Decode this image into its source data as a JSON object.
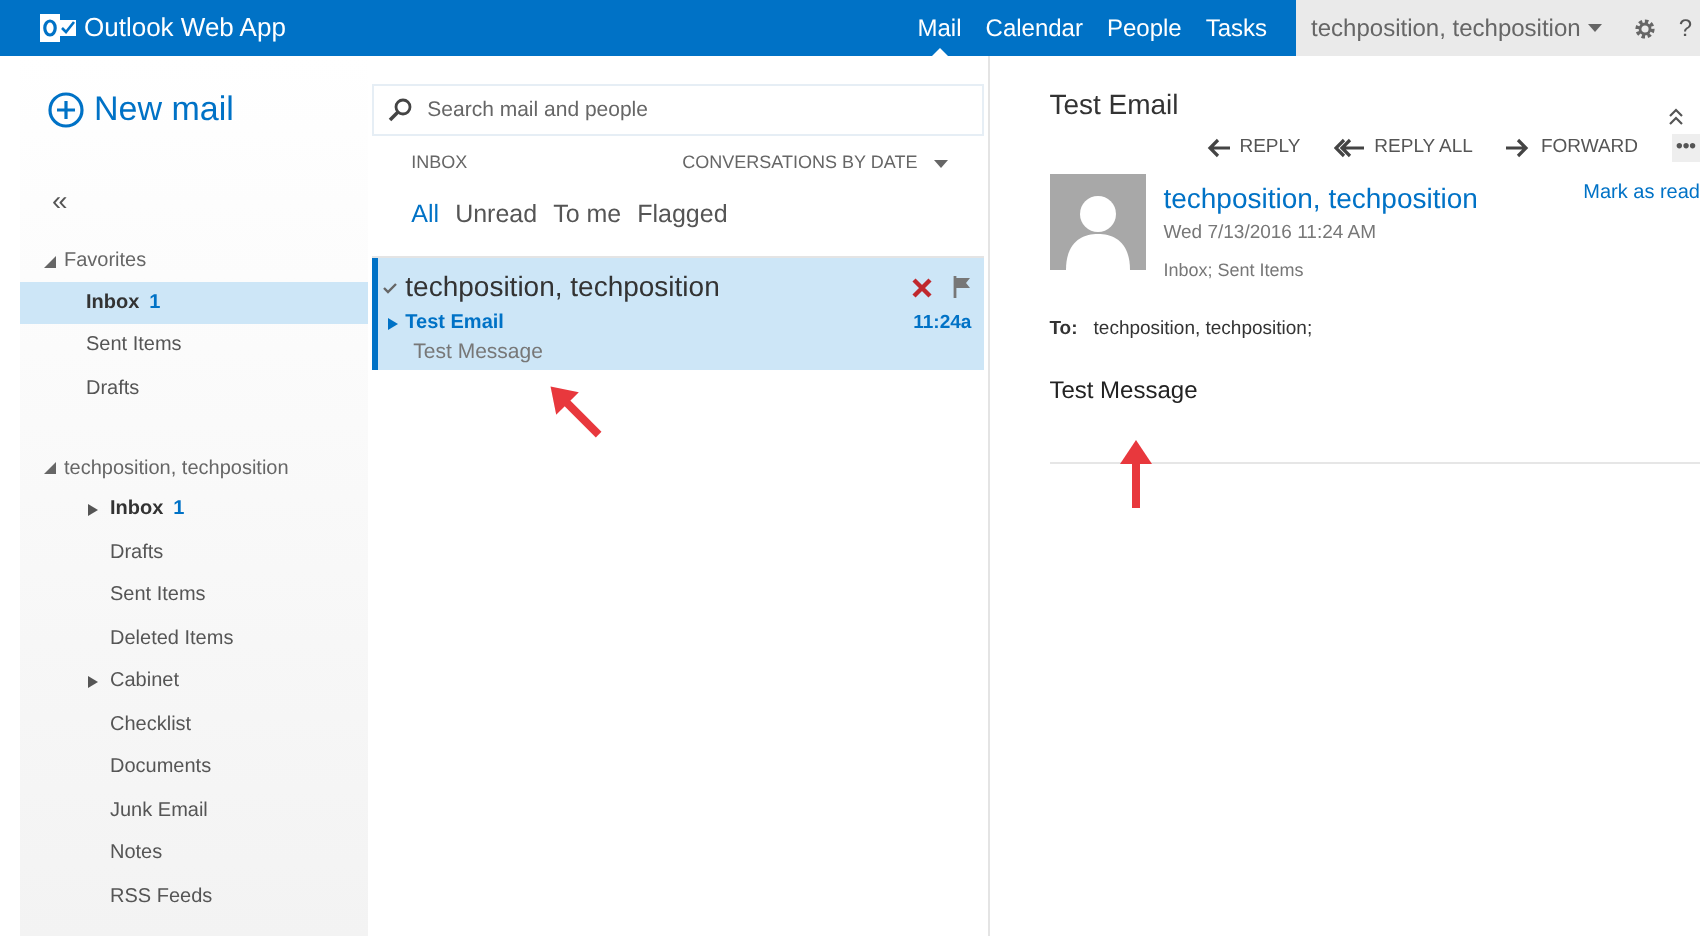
{
  "app_bar": {
    "title": "Outlook Web App",
    "nav": [
      {
        "label": "Mail",
        "selected": true
      },
      {
        "label": "Calendar",
        "selected": false
      },
      {
        "label": "People",
        "selected": false
      },
      {
        "label": "Tasks",
        "selected": false
      }
    ],
    "user": "techposition, techposition",
    "help": "?"
  },
  "new_mail": "New mail",
  "collapse": "«",
  "folder_groups": [
    {
      "label": "Favorites",
      "expanded": true,
      "items": [
        {
          "label": "Inbox",
          "count": "1",
          "selected": true
        },
        {
          "label": "Sent Items",
          "selected": false
        },
        {
          "label": "Drafts",
          "selected": false
        }
      ]
    },
    {
      "label": "techposition, techposition",
      "expanded": true,
      "items": [
        {
          "label": "Inbox",
          "count": "1",
          "selected": false,
          "expanded": false
        },
        {
          "label": "Drafts",
          "selected": false
        },
        {
          "label": "Sent Items",
          "selected": false
        },
        {
          "label": "Deleted Items",
          "selected": false
        },
        {
          "label": "Cabinet",
          "selected": false,
          "expanded": false
        },
        {
          "label": "Checklist",
          "selected": false
        },
        {
          "label": "Documents",
          "selected": false
        },
        {
          "label": "Junk Email",
          "selected": false
        },
        {
          "label": "Notes",
          "selected": false
        },
        {
          "label": "RSS Feeds",
          "selected": false
        }
      ]
    }
  ],
  "message_list": {
    "search": {
      "placeholder": "Search mail and people"
    },
    "folder": "INBOX",
    "sort": "CONVERSATIONS BY DATE",
    "filters": [
      {
        "label": "All",
        "selected": true
      },
      {
        "label": "Unread",
        "selected": false
      },
      {
        "label": "To me",
        "selected": false
      },
      {
        "label": "Flagged",
        "selected": false
      }
    ],
    "messages": [
      {
        "sender": "techposition, techposition",
        "subject": "Test Email",
        "preview": "Test Message",
        "time": "11:24a",
        "selected": true
      }
    ]
  },
  "reading_pane": {
    "subject": "Test Email",
    "actions": [
      {
        "kind": "reply",
        "label": "REPLY"
      },
      {
        "kind": "replyall",
        "label": "REPLY ALL"
      },
      {
        "kind": "forward",
        "label": "FORWARD"
      },
      {
        "kind": "more",
        "label": "•••"
      }
    ],
    "sender": "techposition, techposition",
    "date": "Wed 7/13/2016 11:24 AM",
    "folders": "Inbox; Sent Items",
    "mark_as_read": "Mark as read",
    "to_label": "To:",
    "to": "techposition, techposition;",
    "body": "Test Message"
  }
}
